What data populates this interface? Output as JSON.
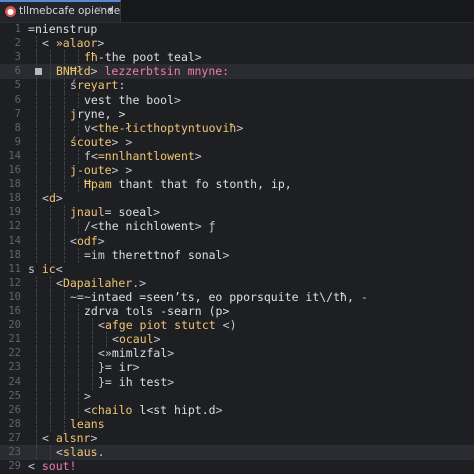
{
  "tab": {
    "icon": "recording-dot-icon",
    "title": "tllmebcafe opiende",
    "close_glyph": "×",
    "dropdown_glyph": "▾"
  },
  "colors": {
    "background": "#1e1f22",
    "line_highlight": "#2a2c31",
    "line_number": "#5f636b",
    "symbol": "#c6c9ce",
    "tag": "#f0c674",
    "text": "#dcdfe4",
    "keyword": "#f07ab2",
    "tab_icon": "#d9534f"
  },
  "lines": [
    {
      "number": "1",
      "indent": 0,
      "segments": [
        {
          "k": "sym",
          "t": "="
        },
        {
          "k": "txt",
          "t": "nienstrup"
        }
      ]
    },
    {
      "number": "2",
      "indent": 1,
      "segments": [
        {
          "k": "sym",
          "t": "< "
        },
        {
          "k": "tag",
          "t": "»alaor"
        },
        {
          "k": "sym",
          "t": ">"
        }
      ]
    },
    {
      "number": "3",
      "indent": 4,
      "segments": [
        {
          "k": "tag",
          "t": "fħ"
        },
        {
          "k": "txt",
          "t": "-the poot teal"
        },
        {
          "k": "sym",
          "t": ">"
        }
      ]
    },
    {
      "number": "6",
      "indent": 2,
      "current": true,
      "marker": true,
      "segments": [
        {
          "k": "tag",
          "t": "BNĦłd"
        },
        {
          "k": "sym",
          "t": "> "
        },
        {
          "k": "key",
          "t": "lezzerbtsin mnyne:"
        }
      ]
    },
    {
      "number": "5",
      "indent": 3,
      "segments": [
        {
          "k": "sym",
          "t": "ś"
        },
        {
          "k": "tag",
          "t": "reyart"
        },
        {
          "k": "sym",
          "t": ":"
        }
      ]
    },
    {
      "number": "6",
      "indent": 4,
      "segments": [
        {
          "k": "txt",
          "t": "vest the bool"
        },
        {
          "k": "sym",
          "t": ">"
        }
      ]
    },
    {
      "number": "7",
      "indent": 3,
      "segments": [
        {
          "k": "tag",
          "t": "j"
        },
        {
          "k": "txt",
          "t": "ryne, >"
        }
      ]
    },
    {
      "number": "8",
      "indent": 4,
      "segments": [
        {
          "k": "sym",
          "t": "v<"
        },
        {
          "k": "tag",
          "t": "the-łicthoptyntuoviħ"
        },
        {
          "k": "sym",
          "t": ">"
        }
      ]
    },
    {
      "number": "9",
      "indent": 3,
      "segments": [
        {
          "k": "tag",
          "t": "ścoute"
        },
        {
          "k": "sym",
          "t": "> >"
        }
      ]
    },
    {
      "number": "14",
      "indent": 4,
      "segments": [
        {
          "k": "sym",
          "t": "f<"
        },
        {
          "k": "tag",
          "t": "=nnlhantlowent"
        },
        {
          "k": "sym",
          "t": ">"
        }
      ]
    },
    {
      "number": "16",
      "indent": 3,
      "segments": [
        {
          "k": "tag",
          "t": "j"
        },
        {
          "k": "sym",
          "t": "-"
        },
        {
          "k": "tag",
          "t": "oute"
        },
        {
          "k": "sym",
          "t": "> >"
        }
      ]
    },
    {
      "number": "18",
      "indent": 4,
      "segments": [
        {
          "k": "tag",
          "t": "Ħpam"
        },
        {
          "k": "txt",
          "t": " thant that fo stonth, ip,"
        }
      ]
    },
    {
      "number": "18",
      "indent": 1,
      "segments": [
        {
          "k": "sym",
          "t": "<"
        },
        {
          "k": "tag",
          "t": "d"
        },
        {
          "k": "sym",
          "t": ">"
        }
      ]
    },
    {
      "number": "19",
      "indent": 3,
      "segments": [
        {
          "k": "tag",
          "t": "jnaul"
        },
        {
          "k": "sym",
          "t": "= "
        },
        {
          "k": "txt",
          "t": "soeal"
        },
        {
          "k": "sym",
          "t": ">"
        }
      ]
    },
    {
      "number": "12",
      "indent": 4,
      "segments": [
        {
          "k": "sym",
          "t": "/<"
        },
        {
          "k": "txt",
          "t": "the nichlowent"
        },
        {
          "k": "sym",
          "t": "> ƒ"
        }
      ]
    },
    {
      "number": "14",
      "indent": 3,
      "segments": [
        {
          "k": "sym",
          "t": "<"
        },
        {
          "k": "tag",
          "t": "odf"
        },
        {
          "k": "sym",
          "t": ">"
        }
      ]
    },
    {
      "number": "18",
      "indent": 4,
      "segments": [
        {
          "k": "sym",
          "t": "=im "
        },
        {
          "k": "txt",
          "t": "therettnof sonal"
        },
        {
          "k": "sym",
          "t": ">"
        }
      ]
    },
    {
      "number": "11",
      "indent": 0,
      "segments": [
        {
          "k": "sym",
          "t": "s "
        },
        {
          "k": "tag",
          "t": "ic"
        },
        {
          "k": "sym",
          "t": "<"
        }
      ]
    },
    {
      "number": "12",
      "indent": 2,
      "segments": [
        {
          "k": "sym",
          "t": "<"
        },
        {
          "k": "tag",
          "t": "Dapailaher"
        },
        {
          "k": "sym",
          "t": ".>"
        }
      ]
    },
    {
      "number": "10",
      "indent": 3,
      "segments": [
        {
          "k": "sym",
          "t": "~=~"
        },
        {
          "k": "txt",
          "t": "intaed =seen’ts, eo pporsquite it\\/tħ,"
        },
        {
          "k": "sym",
          "t": " -"
        }
      ]
    },
    {
      "number": "16",
      "indent": 4,
      "segments": [
        {
          "k": "txt",
          "t": "zdrva tols -searn (p>"
        }
      ]
    },
    {
      "number": "20",
      "indent": 5,
      "segments": [
        {
          "k": "sym",
          "t": "<"
        },
        {
          "k": "tag",
          "t": "afge piot stutct"
        },
        {
          "k": "sym",
          "t": " <)"
        }
      ]
    },
    {
      "number": "21",
      "indent": 6,
      "segments": [
        {
          "k": "sym",
          "t": "<"
        },
        {
          "k": "tag",
          "t": "ocaul"
        },
        {
          "k": "sym",
          "t": ">"
        }
      ]
    },
    {
      "number": "22",
      "indent": 5,
      "segments": [
        {
          "k": "sym",
          "t": "<»"
        },
        {
          "k": "txt",
          "t": "mimlzfal"
        },
        {
          "k": "sym",
          "t": ">"
        }
      ]
    },
    {
      "number": "23",
      "indent": 5,
      "segments": [
        {
          "k": "sym",
          "t": "}= "
        },
        {
          "k": "txt",
          "t": "ir"
        },
        {
          "k": "sym",
          "t": ">"
        }
      ]
    },
    {
      "number": "24",
      "indent": 5,
      "segments": [
        {
          "k": "sym",
          "t": "}= "
        },
        {
          "k": "txt",
          "t": "ih test"
        },
        {
          "k": "sym",
          "t": ">"
        }
      ]
    },
    {
      "number": "25",
      "indent": 4,
      "segments": [
        {
          "k": "sym",
          "t": ">"
        }
      ]
    },
    {
      "number": "26",
      "indent": 4,
      "segments": [
        {
          "k": "sym",
          "t": "<"
        },
        {
          "k": "tag",
          "t": "chailo"
        },
        {
          "k": "txt",
          "t": " l<st hipt.d"
        },
        {
          "k": "sym",
          "t": ">"
        }
      ]
    },
    {
      "number": "28",
      "indent": 3,
      "segments": [
        {
          "k": "tag",
          "t": "leans"
        }
      ]
    },
    {
      "number": "27",
      "indent": 1,
      "segments": [
        {
          "k": "sym",
          "t": "< "
        },
        {
          "k": "tag",
          "t": "alsnr"
        },
        {
          "k": "sym",
          "t": ">"
        }
      ]
    },
    {
      "number": "23",
      "indent": 2,
      "current": true,
      "segments": [
        {
          "k": "sym",
          "t": "<"
        },
        {
          "k": "tag",
          "t": "slaus"
        },
        {
          "k": "sym",
          "t": "."
        }
      ]
    },
    {
      "number": "29",
      "indent": 0,
      "segments": [
        {
          "k": "sym",
          "t": "< "
        },
        {
          "k": "key",
          "t": "sout!"
        }
      ]
    }
  ]
}
